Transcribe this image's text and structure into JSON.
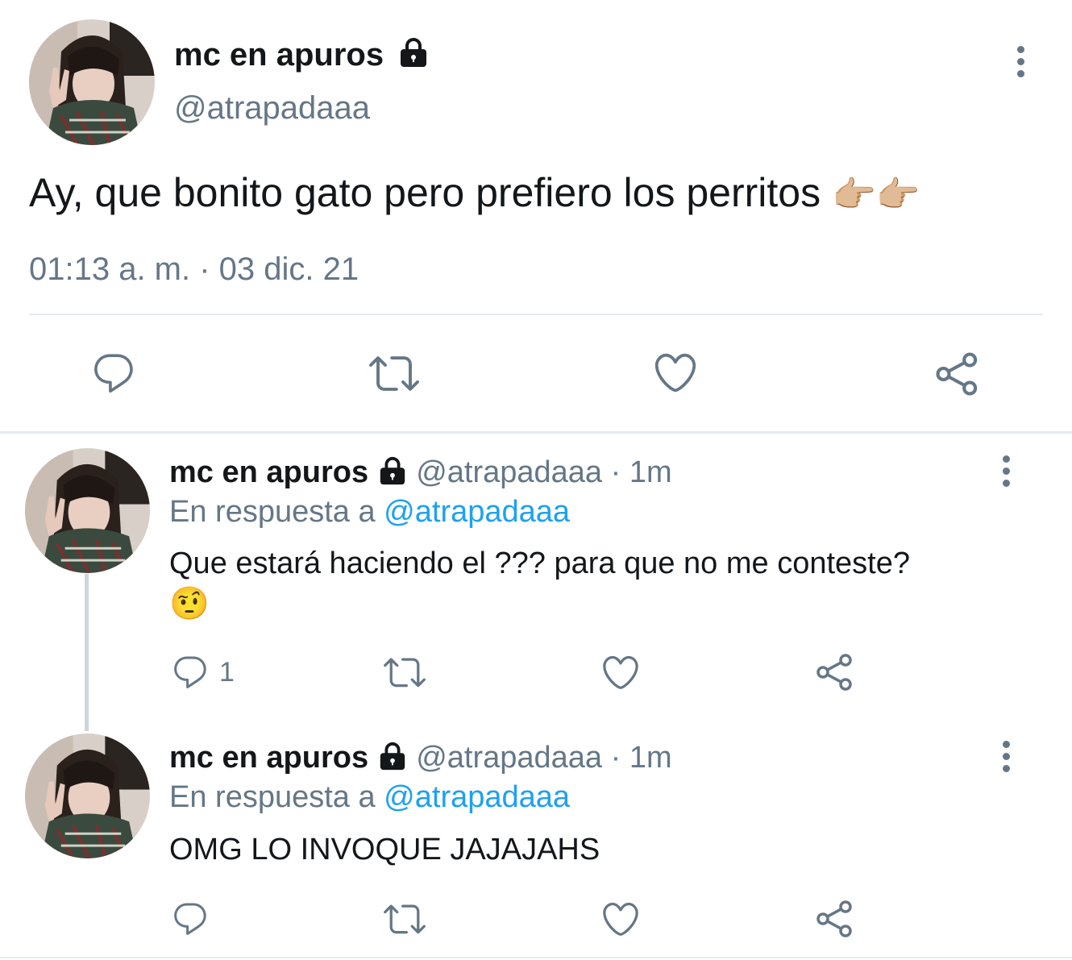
{
  "main_tweet": {
    "name": "mc en apuros",
    "handle": "@atrapadaaa",
    "text": "Ay, que bonito gato pero prefiero los perritos",
    "emoji": "👉🏼👉🏼",
    "timestamp": "01:13 a. m. · 03 dic. 21",
    "icons": [
      "reply-icon",
      "retweet-icon",
      "like-icon",
      "share-icon"
    ]
  },
  "replies": [
    {
      "name": "mc en apuros",
      "handle": "@atrapadaaa",
      "time_sep": "·",
      "time": "1m",
      "replying_prefix": "En respuesta a",
      "replying_to": "@atrapadaaa",
      "text": "Que estará haciendo el ??? para que no me conteste?",
      "emoji": "🤨",
      "reply_count": "1"
    },
    {
      "name": "mc en apuros",
      "handle": "@atrapadaaa",
      "time_sep": "·",
      "time": "1m",
      "replying_prefix": "En respuesta a",
      "replying_to": "@atrapadaaa",
      "text": "OMG LO INVOQUE JAJAJAHS",
      "reply_count": ""
    }
  ],
  "colors": {
    "text": "#14171a",
    "secondary": "#657786",
    "link": "#1da1f2",
    "divider": "#e6ecf0"
  }
}
